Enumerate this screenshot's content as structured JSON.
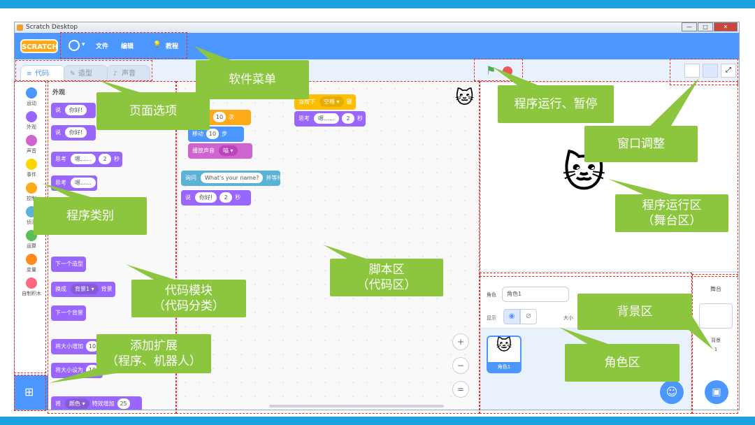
{
  "window": {
    "title": "Scratch Desktop",
    "controls": [
      "—",
      "□",
      "✕"
    ]
  },
  "menu": {
    "logo": "SCRATCH",
    "file": "文件",
    "edit": "编辑",
    "tutorial": "教程",
    "globe_icon": "globe-icon"
  },
  "tabs": [
    {
      "label": "代码"
    },
    {
      "label": "造型"
    },
    {
      "label": "声音"
    }
  ],
  "categories": [
    {
      "label": "运动",
      "color": "#4c97ff"
    },
    {
      "label": "外观",
      "color": "#9966ff"
    },
    {
      "label": "声音",
      "color": "#cf63cf"
    },
    {
      "label": "事件",
      "color": "#ffd500"
    },
    {
      "label": "控制",
      "color": "#ffab19"
    },
    {
      "label": "侦测",
      "color": "#5cb1d6"
    },
    {
      "label": "运算",
      "color": "#59c059"
    },
    {
      "label": "变量",
      "color": "#ff8c1a"
    },
    {
      "label": "自制积木",
      "color": "#ff6680"
    }
  ],
  "palette": {
    "heading": "外观",
    "say": "说",
    "hello": "你好!",
    "think": "思考",
    "hmm": "嗯……",
    "two": "2",
    "sec": "秒",
    "next_costume": "下一个造型",
    "switch_backdrop": "换成",
    "backdrop1": "背景1 ▾",
    "backdrop": "背景",
    "next_backdrop": "下一个背景",
    "change_size": "将大小增加",
    "ten": "10",
    "set_size": "将大小设为",
    "effect_change": "将",
    "color_effect": "颜色 ▾",
    "effect_add": "特效增加",
    "twentyfive": "25",
    "effect_set": "特效设定为",
    "zero": "0"
  },
  "script": {
    "repeat_num": "10",
    "repeat_times": "次",
    "move": "移动",
    "move_steps": "10",
    "step": "步",
    "play_sound": "播放声音",
    "meow": "喵 ▾",
    "ask": "询问",
    "ask_text": "What's your name?",
    "and_wait": "并等待",
    "say": "说",
    "hello": "你好!",
    "two": "2",
    "sec": "秒",
    "when_key": "当按下",
    "space": "空格 ▾",
    "key": "键",
    "think": "思考",
    "hmm": "嗯……",
    "think_two": "2",
    "think_sec": "秒"
  },
  "sprite_info": {
    "sprite_label": "角色",
    "sprite_name": "角色1",
    "show_label": "显示",
    "size_label": "大小"
  },
  "sprite_tile": {
    "name": "角色1"
  },
  "backdrop_pane": {
    "title": "舞台",
    "bg_label": "背景",
    "bg_count": "1"
  },
  "callouts": {
    "menu": "软件菜单",
    "tabs": "页面选项",
    "run": "程序运行、暂停",
    "window": "窗口调整",
    "stage": "程序运行区\n（舞台区）",
    "categories": "程序类别",
    "blocks": "代码模块\n（代码分类）",
    "script": "脚本区\n（代码区）",
    "backdrop": "背景区",
    "sprite": "角色区",
    "extension": "添加扩展\n（程序、机器人）"
  },
  "colors": {
    "accent": "#4c97ff",
    "callout": "#8cc63f",
    "looks": "#9966ff",
    "control": "#ffab19",
    "motion": "#4c97ff",
    "sound": "#cf63cf",
    "sensing": "#5cb1d6",
    "events": "#ffbf00"
  }
}
